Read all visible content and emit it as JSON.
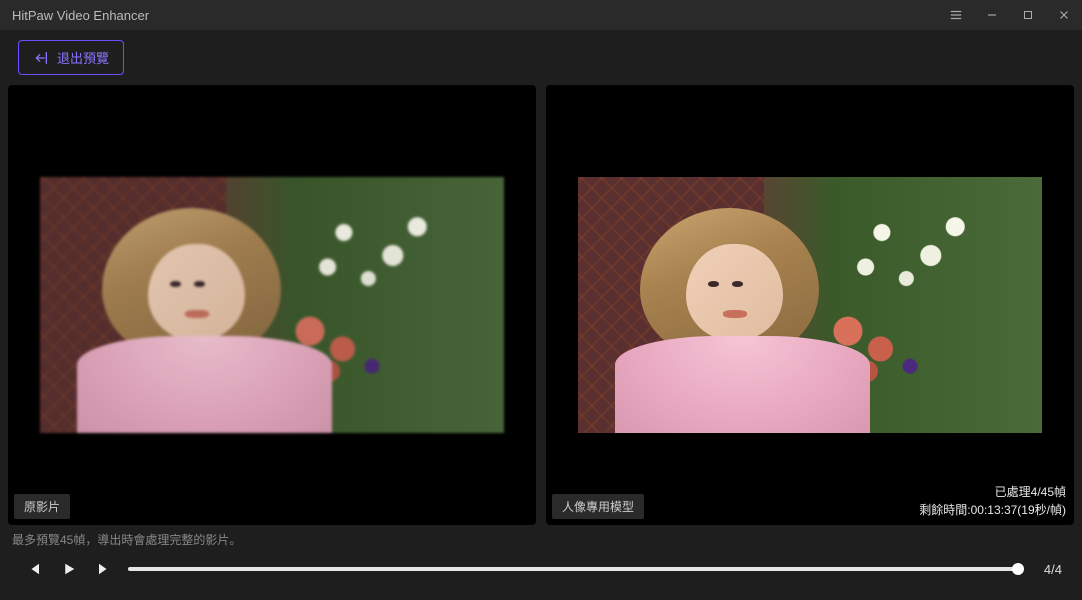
{
  "titlebar": {
    "title": "HitPaw Video Enhancer"
  },
  "toolbar": {
    "exit_preview_label": "退出預覽"
  },
  "panes": {
    "left_label": "原影片",
    "right_label": "人像專用模型",
    "status_line1": "已處理4/45幀",
    "status_line2": "剩餘時間:00:13:37(19秒/幀)"
  },
  "note": "最多預覽45幀，導出時會處理完整的影片。",
  "transport": {
    "counter": "4/4"
  }
}
